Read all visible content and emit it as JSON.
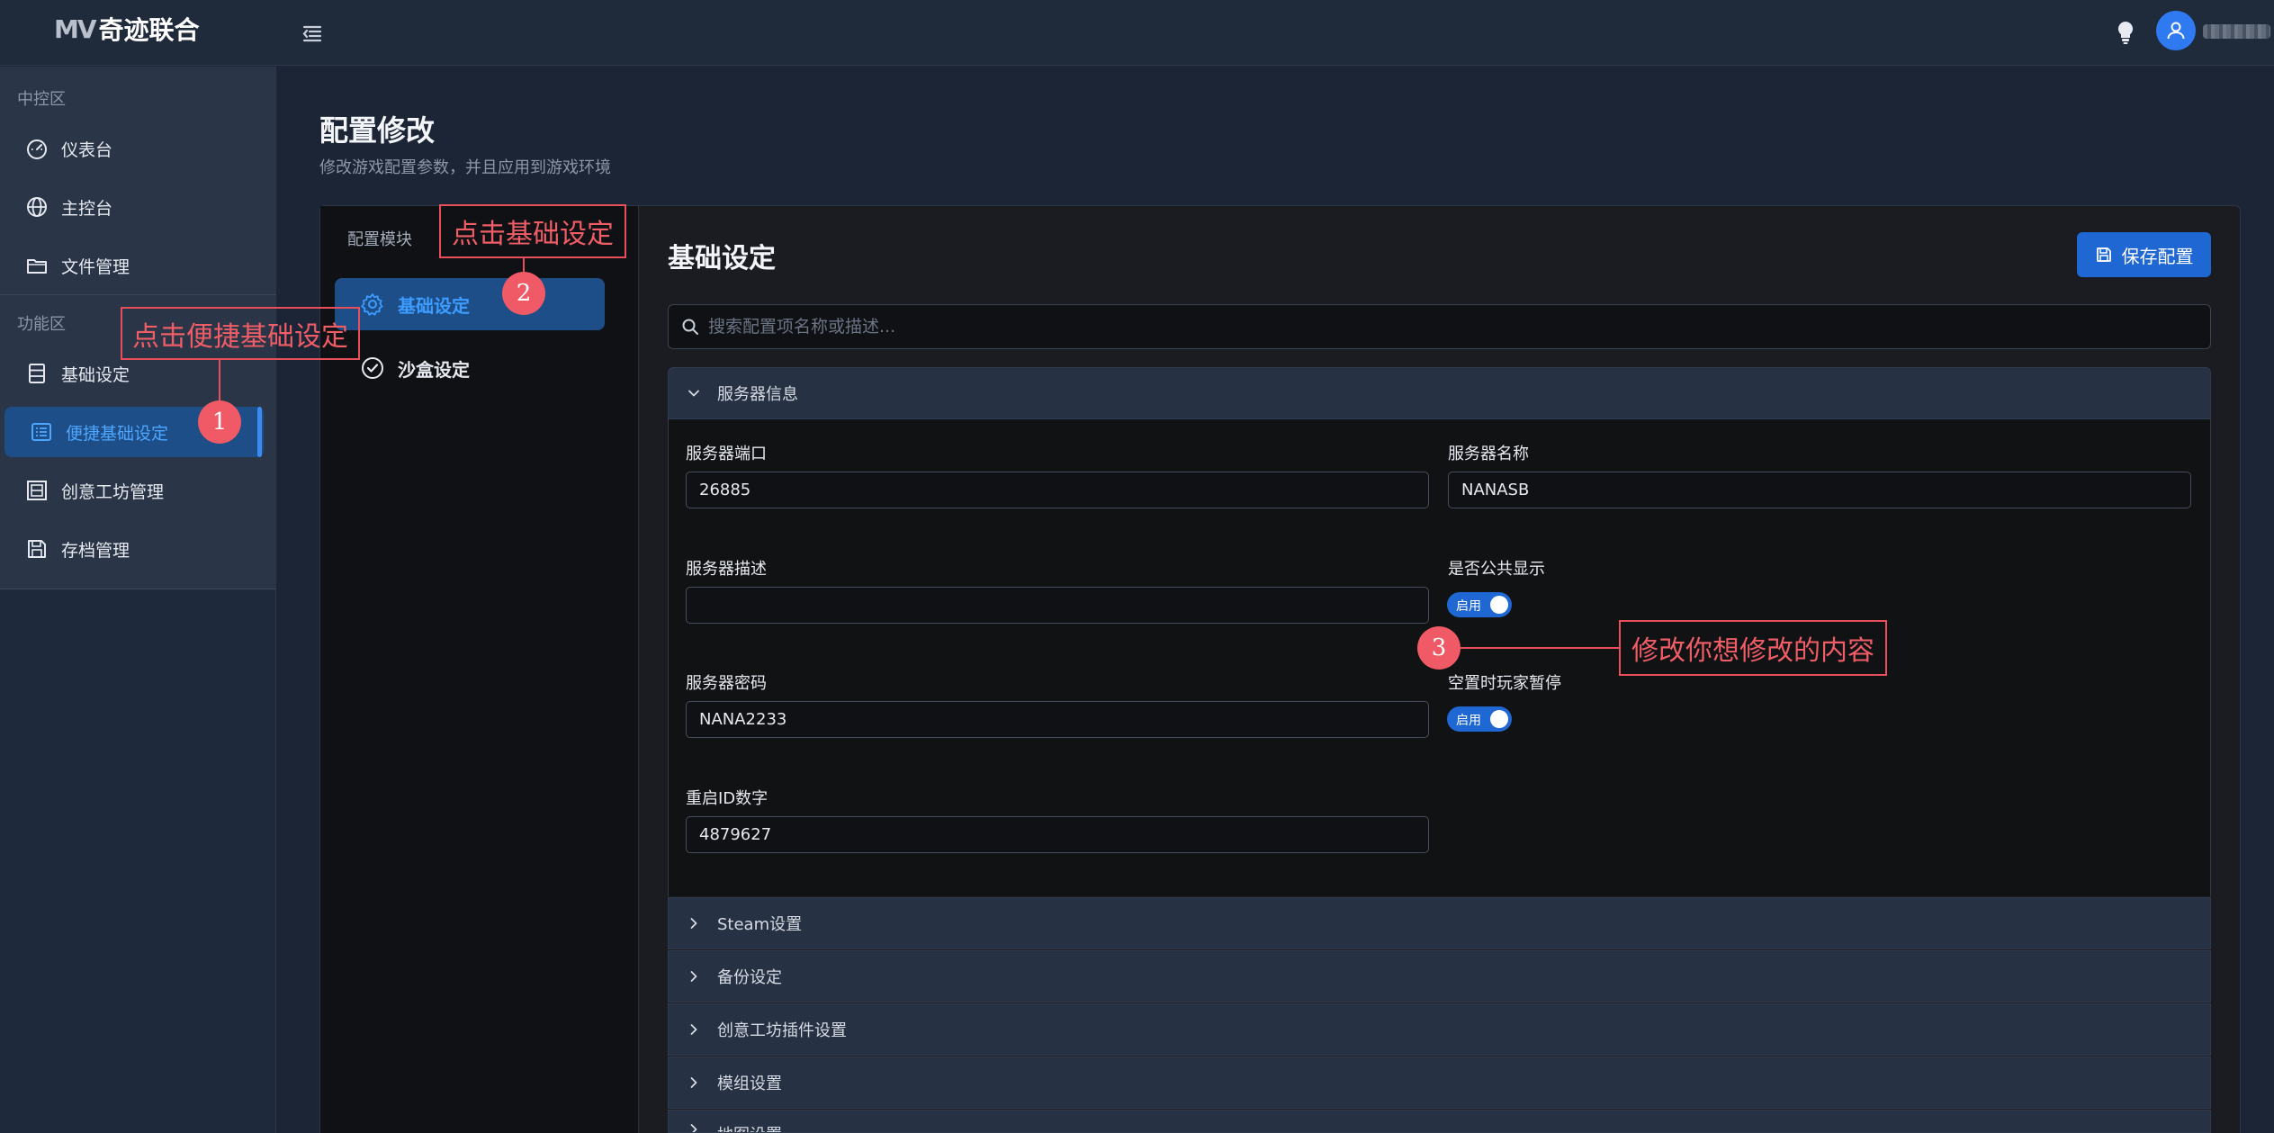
{
  "app": {
    "logo_mark": "MV",
    "logo_text": "奇迹联合"
  },
  "sidebar": {
    "section_control": "中控区",
    "section_function": "功能区",
    "control_items": [
      {
        "label": "仪表台",
        "icon": "dashboard-icon"
      },
      {
        "label": "主控台",
        "icon": "globe-icon"
      },
      {
        "label": "文件管理",
        "icon": "folder-icon"
      }
    ],
    "function_items": [
      {
        "label": "基础设定",
        "icon": "server-icon"
      },
      {
        "label": "便捷基础设定",
        "icon": "list-icon",
        "active": true
      },
      {
        "label": "创意工坊管理",
        "icon": "workshop-icon"
      },
      {
        "label": "存档管理",
        "icon": "save-icon"
      }
    ]
  },
  "page": {
    "title": "配置修改",
    "subtitle": "修改游戏配置参数，并且应用到游戏环境"
  },
  "modules": {
    "title": "配置模块",
    "items": [
      {
        "label": "基础设定",
        "icon": "gear-icon",
        "active": true
      },
      {
        "label": "沙盒设定",
        "icon": "check-circle-icon"
      }
    ]
  },
  "content": {
    "title": "基础设定",
    "save_label": "保存配置",
    "search_placeholder": "搜索配置项名称或描述..."
  },
  "server_panel": {
    "title": "服务器信息",
    "expanded": true,
    "fields": {
      "port": {
        "label": "服务器端口",
        "value": "26885"
      },
      "name": {
        "label": "服务器名称",
        "value": "NANASB"
      },
      "desc": {
        "label": "服务器描述",
        "value": ""
      },
      "public": {
        "label": "是否公共显示",
        "toggle_text": "启用",
        "on": true
      },
      "password": {
        "label": "服务器密码",
        "value": "NANA2233"
      },
      "pause": {
        "label": "空置时玩家暂停",
        "toggle_text": "启用",
        "on": true
      },
      "restart_id": {
        "label": "重启ID数字",
        "value": "4879627"
      }
    }
  },
  "collapsed_panels": [
    "Steam设置",
    "备份设定",
    "创意工坊插件设置",
    "模组设置",
    "地图设置"
  ],
  "annotations": {
    "step1": {
      "num": "1",
      "text": "点击便捷基础设定"
    },
    "step2": {
      "num": "2",
      "text": "点击基础设定"
    },
    "step3": {
      "num": "3",
      "text": "修改你想修改的内容"
    }
  },
  "colors": {
    "accent": "#1f67d2",
    "active_bg": "#1d4e87",
    "annotation": "#e94f5b"
  }
}
